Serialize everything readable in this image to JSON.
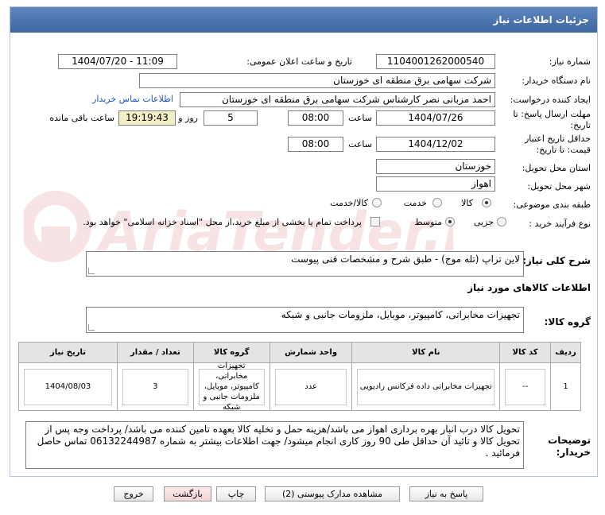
{
  "header": {
    "title": "جزئیات اطلاعات نیاز"
  },
  "fields": {
    "need_number_label": "شماره نیاز:",
    "need_number": "1104001262000540",
    "announce_label": "تاریخ و ساعت اعلان عمومی:",
    "announce_value": "1404/07/20 - 11:09",
    "buyer_org_label": "نام دستگاه خریدار:",
    "buyer_org": "شرکت سهامی برق منطقه ای خوزستان",
    "requester_label": "ایجاد کننده درخواست:",
    "requester": "احمد مزبانی نصر کارشناس شرکت سهامی برق منطقه ای خوزستان",
    "contact_link": "اطلاعات تماس خریدار",
    "deadline_label_1": "مهلت ارسال پاسخ: تا",
    "deadline_label_2": "تاریخ:",
    "deadline_date": "1404/07/26",
    "time_label": "ساعت",
    "deadline_time": "08:00",
    "days_value": "5",
    "days_label": "روز و",
    "remaining_time": "19:19:43",
    "remaining_label": "ساعت باقی مانده",
    "validity_label_1": "حداقل تاریخ اعتبار",
    "validity_label_2": "قیمت: تا تاریخ:",
    "validity_date": "1404/12/02",
    "validity_time_label": "ساعت",
    "validity_time": "08:00",
    "province_label": "استان محل تحویل:",
    "province": "خوزستان",
    "city_label": "شهر محل تحویل:",
    "city": "اهواز",
    "category_label": "طبقه بندی موضوعی:",
    "category_options": [
      "کالا",
      "خدمت",
      "کالا/خدمت"
    ],
    "process_label": "نوع فرآیند خرید :",
    "process_options": [
      "جزیی",
      "متوسط"
    ],
    "payment_note": "پرداخت تمام یا بخشی از مبلغ خرید،از محل \"اسناد خزانه اسلامی\" خواهد بود."
  },
  "description": {
    "label": "شرح کلی نیاز:",
    "value": "لاین تراپ (تله موج) - طبق شرح و مشخصات فنی پیوست"
  },
  "goods_section_title": "اطلاعات کالاهای مورد نیاز",
  "goods_group": {
    "label": "گروه کالا:",
    "value": "تجهیزات مخابراتی، کامپیوتر، موبایل، ملزومات جانبی و شبکه"
  },
  "table": {
    "headers": [
      "ردیف",
      "کد کالا",
      "نام کالا",
      "واحد شمارش",
      "گروه کالا",
      "تعداد / مقدار",
      "تاریخ نیاز"
    ],
    "rows": [
      {
        "row": "1",
        "code": "--",
        "name": "تجهیزات مخابراتی داده فرکانس رادیویی",
        "unit": "عدد",
        "group": "تجهیزات مخابراتی، کامپیوتر، موبایل، ملزومات جانبی و شبکه",
        "qty": "3",
        "date": "1404/08/03"
      }
    ]
  },
  "buyer_notes": {
    "label_1": "توضیحات",
    "label_2": "خریدار:",
    "value": "تحویل کالا درب انبار بهره برداری اهواز می باشد/هزینه حمل و تخلیه کالا بعهده تامین کننده می باشد/ پرداخت وجه پس از تحویل کالا و تائید آن حداقل طی 90 روز کاری انجام میشود/  جهت اطلاعات بیشتر به شماره  06132244987 تماس حاصل فرمائید ."
  },
  "buttons": {
    "reply": "پاسخ به نیاز",
    "attachments": "مشاهده مدارک پیوستی (2)",
    "print": "چاپ",
    "back": "بازگشت",
    "exit": "خروج"
  },
  "watermark_text": "AriaTender.neT",
  "colors": {
    "header": "#4a72ab",
    "link": "#1f55c6",
    "remaining_bg": "#f3efc4"
  }
}
